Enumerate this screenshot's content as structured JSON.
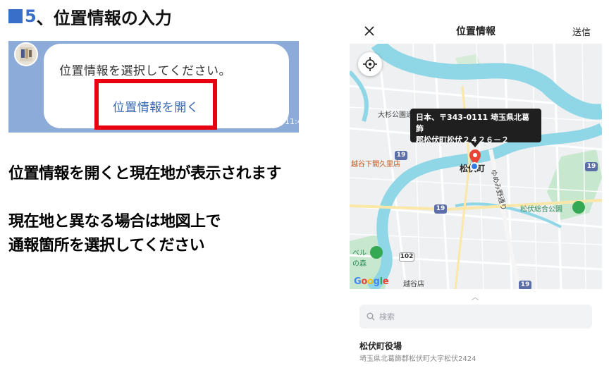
{
  "heading": {
    "number": "5",
    "text": "、位置情報の入力",
    "color": "#3a6fc9"
  },
  "chat": {
    "prompt": "位置情報を選択してください。",
    "button_label": "位置情報を開く",
    "time": "11:4",
    "highlight_color": "#e60012",
    "link_color": "#3767b0",
    "background_color": "#8dabd8"
  },
  "instructions": {
    "line1": "位置情報を開くと現在地が表示されます",
    "line2": "現在地と異なる場合は地図上で",
    "line3": "通報箇所を選択してください"
  },
  "phone": {
    "header": {
      "close_icon": "close-icon",
      "title": "位置情報",
      "send": "送信"
    },
    "map": {
      "locate_icon": "crosshair-icon",
      "tooltip_line1": "日本、〒343-0111 埼玉県北葛飾",
      "tooltip_line2": "郡松伏町松伏２４２６－２",
      "labels": {
        "park_top": "大杉公園通",
        "station": "越谷下間久里店",
        "town": "松伏町",
        "road": "ゆめみ野通り",
        "sports_park": "松伏総合公園",
        "bell": "ベル",
        "forest": "の森",
        "store": "越谷店"
      },
      "routes": [
        "19",
        "19",
        "19",
        "102"
      ],
      "google": [
        "G",
        "o",
        "o",
        "g",
        "l",
        "e"
      ],
      "colors": {
        "river": "#8fd6e6",
        "land": "#eef0f1",
        "park": "#c7e8cf",
        "pin": "#ea4335",
        "dot": "#2f7be5"
      }
    },
    "search": {
      "icon": "search-icon",
      "placeholder": "検索"
    },
    "result": {
      "name": "松伏町役場",
      "address": "埼玉県北葛飾郡松伏町大字松伏2424"
    }
  }
}
